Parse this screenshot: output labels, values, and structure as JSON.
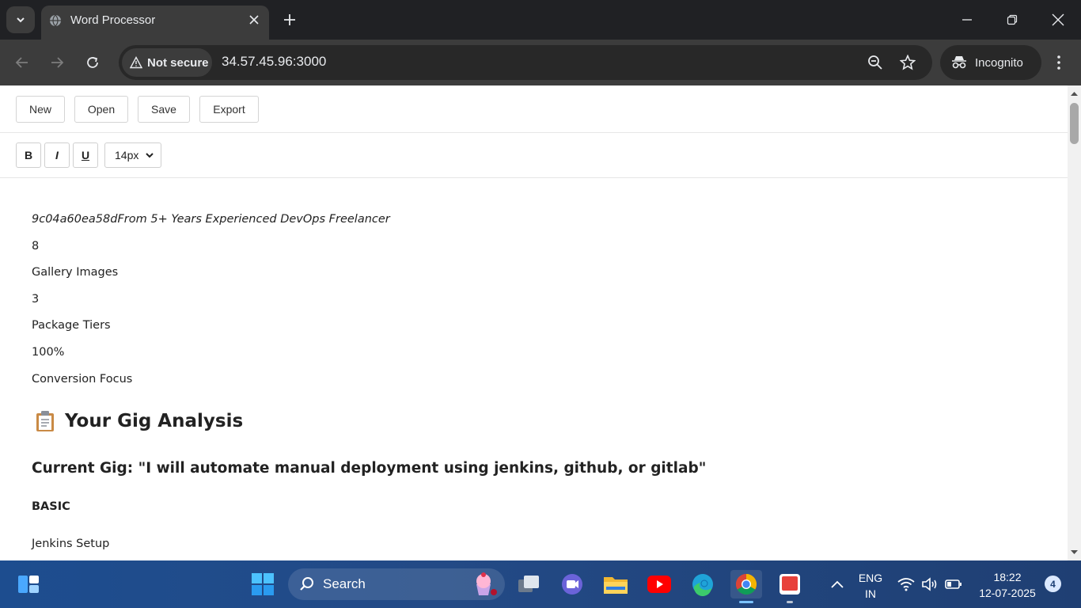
{
  "browser": {
    "tab_title": "Word Processor",
    "security_label": "Not secure",
    "url": "34.57.45.96:3000",
    "incognito_label": "Incognito"
  },
  "menubar": {
    "new": "New",
    "open": "Open",
    "save": "Save",
    "export": "Export"
  },
  "formatbar": {
    "bold": "B",
    "italic": "I",
    "underline": "U",
    "font_size": "14px"
  },
  "document": {
    "intro_line": "9c04a60ea58dFrom 5+ Years Experienced DevOps Freelancer",
    "stats": [
      {
        "value": "8",
        "label": "Gallery Images"
      },
      {
        "value": "3",
        "label": "Package Tiers"
      },
      {
        "value": "100%",
        "label": "Conversion Focus"
      }
    ],
    "section_icon": "clipboard-icon",
    "section_heading": "Your Gig Analysis",
    "current_gig": "Current Gig: \"I will automate manual deployment using jenkins, github, or gitlab\"",
    "tier_heading": "BASIC",
    "tier_item": "Jenkins Setup"
  },
  "taskbar": {
    "search_label": "Search",
    "lang_line1": "ENG",
    "lang_line2": "IN",
    "time": "18:22",
    "date": "12-07-2025",
    "notification_count": "4"
  }
}
